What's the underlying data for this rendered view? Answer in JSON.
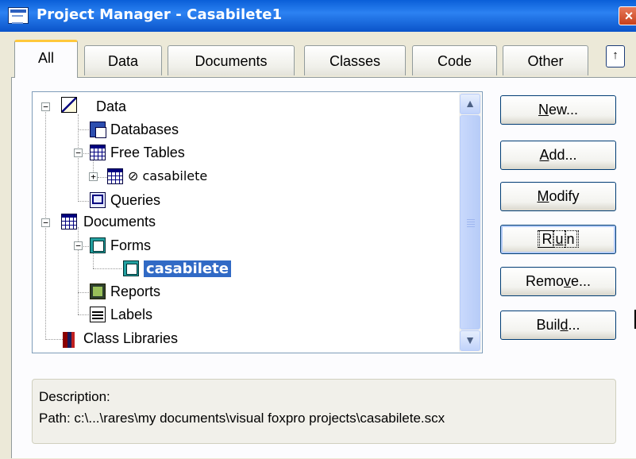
{
  "window": {
    "title": "Project Manager - Casabilete1",
    "close_glyph": "×"
  },
  "tabs": [
    {
      "label": "All",
      "active": true
    },
    {
      "label": "Data"
    },
    {
      "label": "Documents"
    },
    {
      "label": "Classes"
    },
    {
      "label": "Code"
    },
    {
      "label": "Other"
    }
  ],
  "tab_scroll_glyph": "↑",
  "tree": {
    "items": [
      {
        "label": "Data",
        "icon": "data-icon",
        "expander": "−"
      },
      {
        "label": "Databases",
        "icon": "database-icon"
      },
      {
        "label": "Free Tables",
        "icon": "table-icon",
        "expander": "−"
      },
      {
        "label": "⊘ casabilete",
        "icon": "table-icon",
        "expander": "+"
      },
      {
        "label": "Queries",
        "icon": "query-icon"
      },
      {
        "label": "Documents",
        "icon": "table-icon",
        "expander": "−"
      },
      {
        "label": "Forms",
        "icon": "form-icon",
        "expander": "−"
      },
      {
        "label": "casabilete",
        "icon": "form-icon",
        "selected": true
      },
      {
        "label": "Reports",
        "icon": "report-icon"
      },
      {
        "label": "Labels",
        "icon": "label-icon"
      },
      {
        "label": "Class Libraries",
        "icon": "class-library-icon"
      }
    ]
  },
  "scrollbar": {
    "up_glyph": "▲",
    "down_glyph": "▼"
  },
  "buttons": {
    "new": {
      "pre": "",
      "ul": "N",
      "post": "ew..."
    },
    "add": {
      "pre": "",
      "ul": "A",
      "post": "dd..."
    },
    "modify": {
      "pre": "",
      "ul": "M",
      "post": "odify"
    },
    "run": {
      "pre": "R",
      "ul": "u",
      "post": "n"
    },
    "remove": {
      "pre": "Remo",
      "ul": "v",
      "post": "e..."
    },
    "build": {
      "pre": "Buil",
      "ul": "d",
      "post": "..."
    }
  },
  "description": {
    "label": "Description:",
    "path": "Path: c:\\...\\rares\\my documents\\visual foxpro projects\\casabilete.scx"
  },
  "colors": {
    "titlebar": "#0A5FD8",
    "selection": "#316AC5",
    "active_tab_accent": "#FFC83C"
  }
}
